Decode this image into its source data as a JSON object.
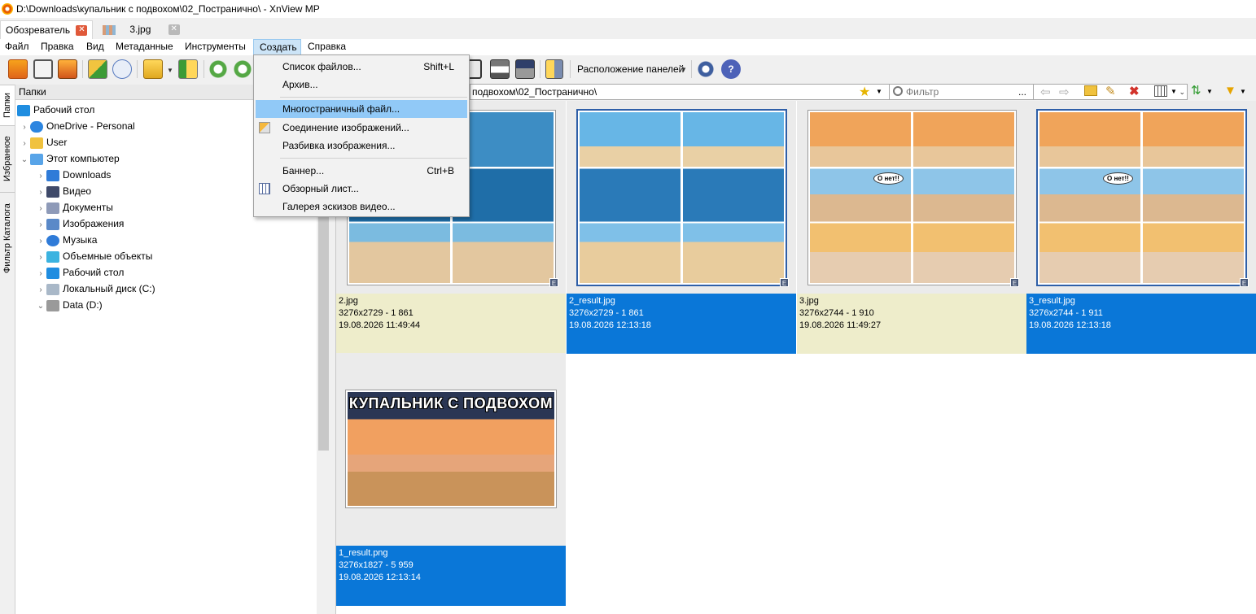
{
  "window": {
    "title": "D:\\Downloads\\купальник с подвохом\\02_Постранично\\ - XnView MP"
  },
  "doc_tabs": [
    {
      "label": "Обозреватель",
      "active": true
    },
    {
      "label": "3.jpg",
      "active": false
    }
  ],
  "menubar": {
    "items": [
      "Файл",
      "Правка",
      "Вид",
      "Метаданные",
      "Инструменты",
      "Создать",
      "Справка"
    ],
    "open": "Создать"
  },
  "create_menu": {
    "items": [
      {
        "label": "Список файлов...",
        "shortcut": "Shift+L"
      },
      {
        "label": "Архив...",
        "shortcut": ""
      },
      {
        "label": "Многостраничный файл...",
        "shortcut": "",
        "highlighted": true
      },
      {
        "label": "Соединение изображений...",
        "shortcut": ""
      },
      {
        "label": "Разбивка изображения...",
        "shortcut": ""
      },
      {
        "label": "Баннер...",
        "shortcut": "Ctrl+B"
      },
      {
        "label": "Обзорный лист...",
        "shortcut": ""
      },
      {
        "label": "Галерея эскизов видео...",
        "shortcut": ""
      }
    ]
  },
  "toolbar": {
    "layout_label": "Расположение панелей"
  },
  "side_tabs": [
    "Папки",
    "Избранное",
    "Фильтр Каталога"
  ],
  "folders": {
    "header": "Папки",
    "items": [
      {
        "label": "Рабочий стол",
        "level": 0,
        "arrow": "",
        "icon": "desktop-icon"
      },
      {
        "label": "OneDrive - Personal",
        "level": 1,
        "arrow": "›",
        "icon": "cloud-icon"
      },
      {
        "label": "User",
        "level": 1,
        "arrow": "›",
        "icon": "user-folder-icon"
      },
      {
        "label": "Этот компьютер",
        "level": 1,
        "arrow": "⌄",
        "icon": "computer-icon"
      },
      {
        "label": "Downloads",
        "level": 2,
        "arrow": "›",
        "icon": "download-icon"
      },
      {
        "label": "Видео",
        "level": 2,
        "arrow": "›",
        "icon": "video-icon"
      },
      {
        "label": "Документы",
        "level": 2,
        "arrow": "›",
        "icon": "documents-icon"
      },
      {
        "label": "Изображения",
        "level": 2,
        "arrow": "›",
        "icon": "pictures-icon"
      },
      {
        "label": "Музыка",
        "level": 2,
        "arrow": "›",
        "icon": "music-icon"
      },
      {
        "label": "Объемные объекты",
        "level": 2,
        "arrow": "›",
        "icon": "3d-objects-icon"
      },
      {
        "label": "Рабочий стол",
        "level": 2,
        "arrow": "›",
        "icon": "desktop-icon"
      },
      {
        "label": "Локальный диск (C:)",
        "level": 2,
        "arrow": "›",
        "icon": "drive-c-icon"
      },
      {
        "label": "Data (D:)",
        "level": 2,
        "arrow": "⌄",
        "icon": "drive-d-icon"
      }
    ]
  },
  "address": {
    "path_visible": "подвохом\\02_Постранично\\",
    "filter_placeholder": "Фильтр",
    "filter_dots": "..."
  },
  "files": [
    {
      "name": "2.jpg",
      "dims": "3276x2729 - 1 861",
      "date": "19.08.2026 11:49:44",
      "selected": false
    },
    {
      "name": "2_result.jpg",
      "dims": "3276x2729 - 1 861",
      "date": "19.08.2026 12:13:18",
      "selected": true
    },
    {
      "name": "3.jpg",
      "dims": "3276x2744 - 1 910",
      "date": "19.08.2026 11:49:27",
      "selected": false
    },
    {
      "name": "3_result.jpg",
      "dims": "3276x2744 - 1 911",
      "date": "19.08.2026 12:13:18",
      "selected": true
    },
    {
      "name": "1_result.png",
      "dims": "3276x1827 - 5 959",
      "date": "19.08.2026 12:13:14",
      "selected": true
    }
  ],
  "banner_text": "КУПАЛЬНИК С ПОДВОХОМ",
  "comic_bubble": "О нет!!",
  "badge": "E",
  "colors": {
    "selection": "#0a77d8",
    "unselected_info": "#eeedcb",
    "menu_highlight": "#91c9f7"
  }
}
